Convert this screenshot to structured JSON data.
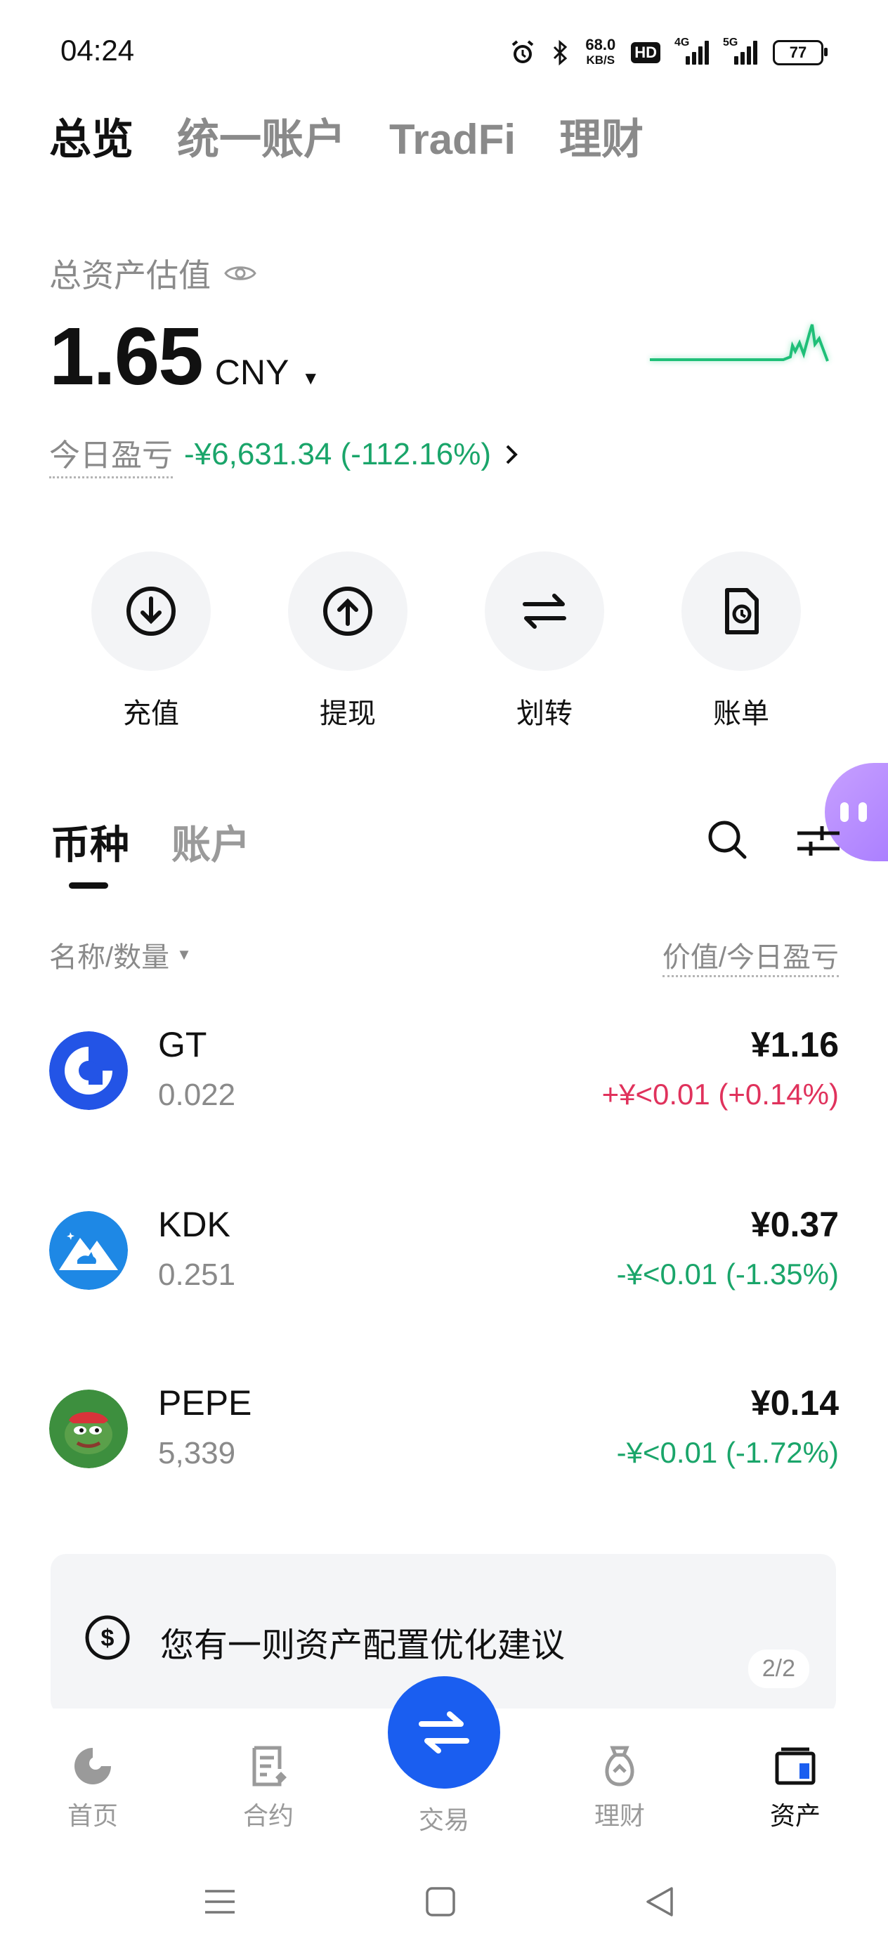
{
  "status": {
    "time": "04:24",
    "speed_value": "68.0",
    "speed_unit": "KB/S",
    "hd": "HD",
    "net4g": "4G",
    "net5g": "5G",
    "battery": "77"
  },
  "top_tabs": [
    {
      "label": "总览",
      "active": true
    },
    {
      "label": "统一账户",
      "active": false
    },
    {
      "label": "TradFi",
      "active": false
    },
    {
      "label": "理财",
      "active": false
    }
  ],
  "overview": {
    "label": "总资产估值",
    "value": "1.65",
    "currency": "CNY",
    "pnl_label": "今日盈亏",
    "pnl_value": "-¥6,631.34 (-112.16%)"
  },
  "actions": [
    {
      "label": "充值",
      "icon": "deposit-icon"
    },
    {
      "label": "提现",
      "icon": "withdraw-icon"
    },
    {
      "label": "划转",
      "icon": "transfer-icon"
    },
    {
      "label": "账单",
      "icon": "bill-icon"
    }
  ],
  "coin_tabs": [
    {
      "label": "币种",
      "active": true
    },
    {
      "label": "账户",
      "active": false
    }
  ],
  "list_header": {
    "left": "名称/数量",
    "right": "价值/今日盈亏"
  },
  "coins": [
    {
      "symbol": "GT",
      "qty": "0.022",
      "value": "¥1.16",
      "pnl": "+¥<0.01 (+0.14%)",
      "direction": "up"
    },
    {
      "symbol": "KDK",
      "qty": "0.251",
      "value": "¥0.37",
      "pnl": "-¥<0.01 (-1.35%)",
      "direction": "down"
    },
    {
      "symbol": "PEPE",
      "qty": "5,339",
      "value": "¥0.14",
      "pnl": "-¥<0.01 (-1.72%)",
      "direction": "down"
    }
  ],
  "suggestion": {
    "text": "您有一则资产配置优化建议",
    "page": "2/2"
  },
  "bottom_nav": [
    {
      "label": "首页",
      "icon": "home-icon"
    },
    {
      "label": "合约",
      "icon": "contract-icon"
    },
    {
      "label": "交易",
      "icon": "trade-icon"
    },
    {
      "label": "理财",
      "icon": "finance-icon"
    },
    {
      "label": "资产",
      "icon": "assets-icon",
      "active": true
    }
  ],
  "colors": {
    "green": "#1aa56a",
    "red": "#e0325c",
    "brand_blue": "#1a5ef0"
  }
}
